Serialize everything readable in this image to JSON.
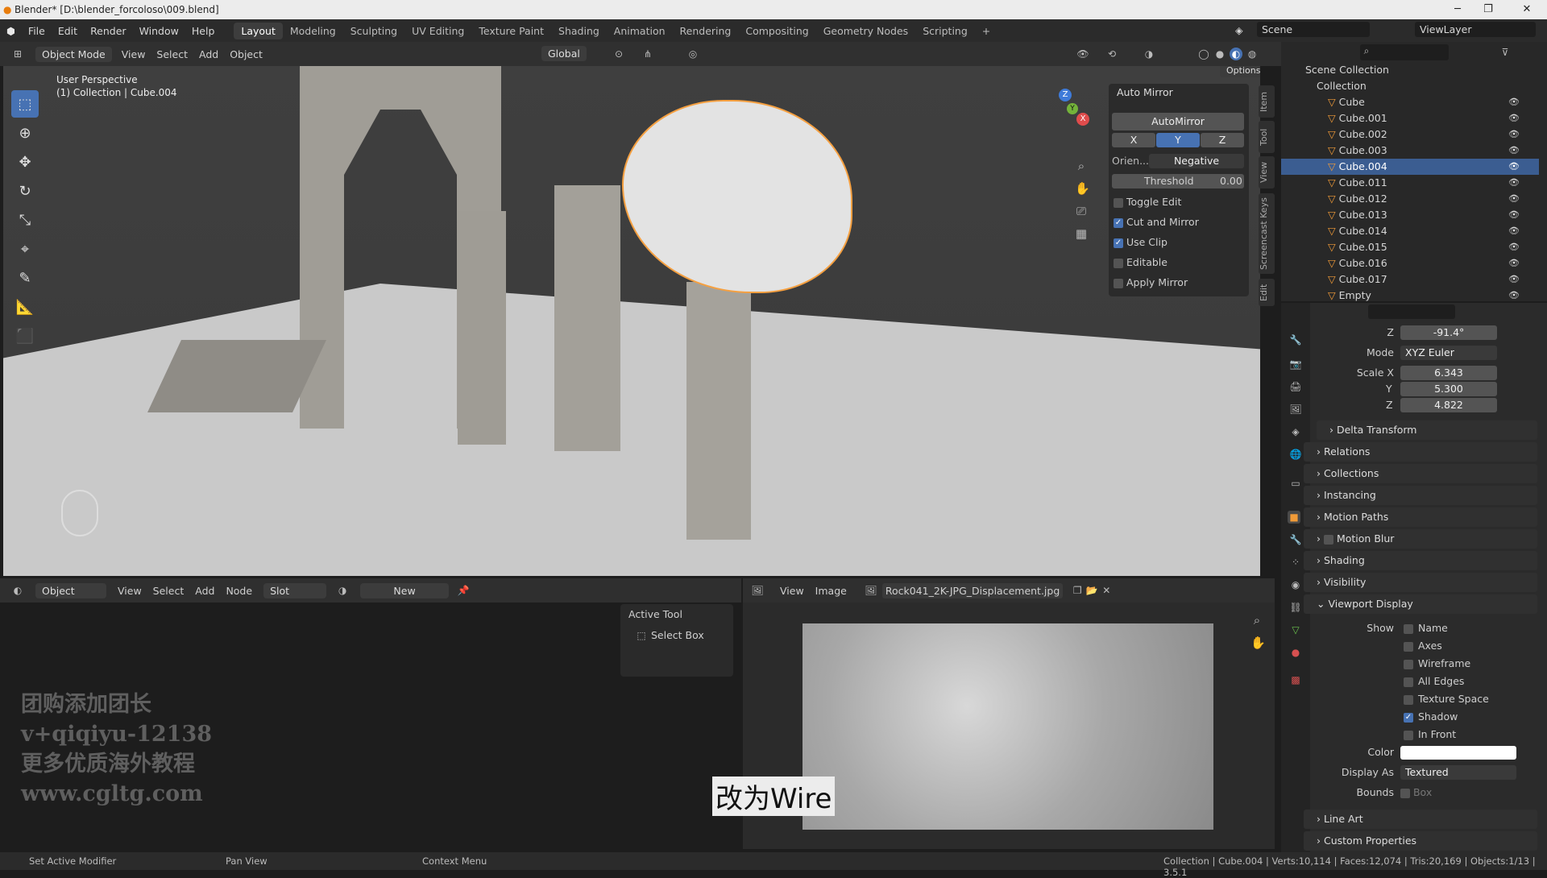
{
  "window": {
    "title": "Blender* [D:\\blender_forcoloso\\009.blend]"
  },
  "menu": [
    "File",
    "Edit",
    "Render",
    "Window",
    "Help"
  ],
  "workspaces": [
    "Layout",
    "Modeling",
    "Sculpting",
    "UV Editing",
    "Texture Paint",
    "Shading",
    "Animation",
    "Rendering",
    "Compositing",
    "Geometry Nodes",
    "Scripting",
    "+"
  ],
  "scene": "Scene",
  "viewlayer": "ViewLayer",
  "viewport_header": {
    "mode": "Object Mode",
    "menus": [
      "View",
      "Select",
      "Add",
      "Object"
    ],
    "orientation": "Global",
    "options": "Options"
  },
  "viewport": {
    "perspective": "User Perspective",
    "collection_line": "(1) Collection | Cube.004"
  },
  "tabs": [
    "Item",
    "Tool",
    "View",
    "Screencast Keys",
    "Edit"
  ],
  "auto_mirror": {
    "title": "Auto Mirror",
    "button": "AutoMirror",
    "axes": [
      "X",
      "Y",
      "Z"
    ],
    "orient_label": "Orien...",
    "orient_value": "Negative",
    "threshold_label": "Threshold",
    "threshold_value": "0.00",
    "toggle_edit": "Toggle Edit",
    "cut_mirror": "Cut and Mirror",
    "use_clip": "Use Clip",
    "editable": "Editable",
    "apply_mirror": "Apply Mirror"
  },
  "outliner": {
    "scene_collection": "Scene Collection",
    "collection": "Collection",
    "items": [
      "Cube",
      "Cube.001",
      "Cube.002",
      "Cube.003",
      "Cube.004",
      "Cube.011",
      "Cube.012",
      "Cube.013",
      "Cube.014",
      "Cube.015",
      "Cube.016",
      "Cube.017",
      "Empty"
    ],
    "selected": "Cube.004"
  },
  "properties": {
    "rot_z_label": "Z",
    "rot_z": "-91.4°",
    "mode_label": "Mode",
    "mode": "XYZ Euler",
    "scale_x_label": "Scale X",
    "scale_x": "6.343",
    "scale_y_label": "Y",
    "scale_y": "5.300",
    "scale_z_label": "Z",
    "scale_z": "4.822",
    "sections": [
      "Delta Transform",
      "Relations",
      "Collections",
      "Instancing",
      "Motion Paths",
      "Motion Blur",
      "Shading",
      "Visibility",
      "Viewport Display",
      "Line Art",
      "Custom Properties"
    ],
    "show_label": "Show",
    "show": [
      "Name",
      "Axes",
      "Wireframe",
      "All Edges",
      "Texture Space",
      "Shadow",
      "In Front"
    ],
    "color_label": "Color",
    "display_as_label": "Display As",
    "display_as": "Textured",
    "bounds_label": "Bounds",
    "bounds": "Box"
  },
  "node_header": {
    "type": "Object",
    "menus": [
      "View",
      "Select",
      "Add",
      "Node"
    ],
    "slot": "Slot",
    "new": "New"
  },
  "active_tool": {
    "title": "Active Tool",
    "tool": "Select Box"
  },
  "image_header": {
    "menus": [
      "View",
      "Image"
    ],
    "image": "Rock041_2K-JPG_Displacement.jpg"
  },
  "watermark": [
    "团购添加团长",
    "v+qiqiyu-12138",
    "更多优质海外教程",
    "www.cgltg.com"
  ],
  "subtitle": "改为Wire",
  "status": {
    "left": "Set Active Modifier",
    "mid": "Pan View",
    "right": "Context Menu",
    "info": "Collection | Cube.004 | Verts:10,114 | Faces:12,074 | Tris:20,169 | Objects:1/13 | 3.5.1"
  }
}
